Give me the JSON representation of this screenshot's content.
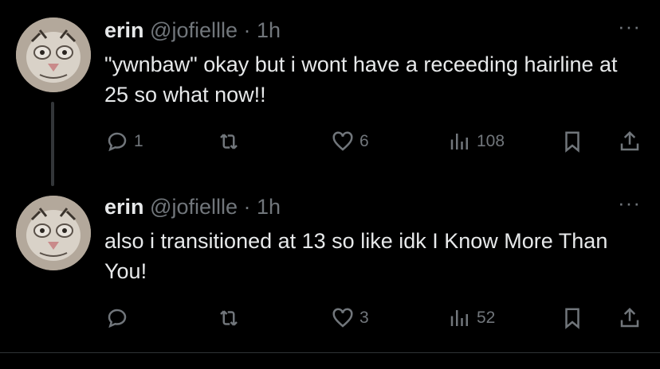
{
  "tweets": [
    {
      "name": "erin",
      "handle": "@jofiellle",
      "separator": "·",
      "time": "1h",
      "more": "···",
      "text": "\"ywnbaw\" okay but i wont have a receeding hairline at 25 so what now!!",
      "replies": "1",
      "retweets": "",
      "likes": "6",
      "views": "108"
    },
    {
      "name": "erin",
      "handle": "@jofiellle",
      "separator": "·",
      "time": "1h",
      "more": "···",
      "text": "also i transitioned at 13 so like idk I Know More Than You!",
      "replies": "",
      "retweets": "",
      "likes": "3",
      "views": "52"
    }
  ],
  "colors": {
    "background": "#000000",
    "text": "#e7e9ea",
    "muted": "#71767b",
    "thread_line": "#333639"
  }
}
